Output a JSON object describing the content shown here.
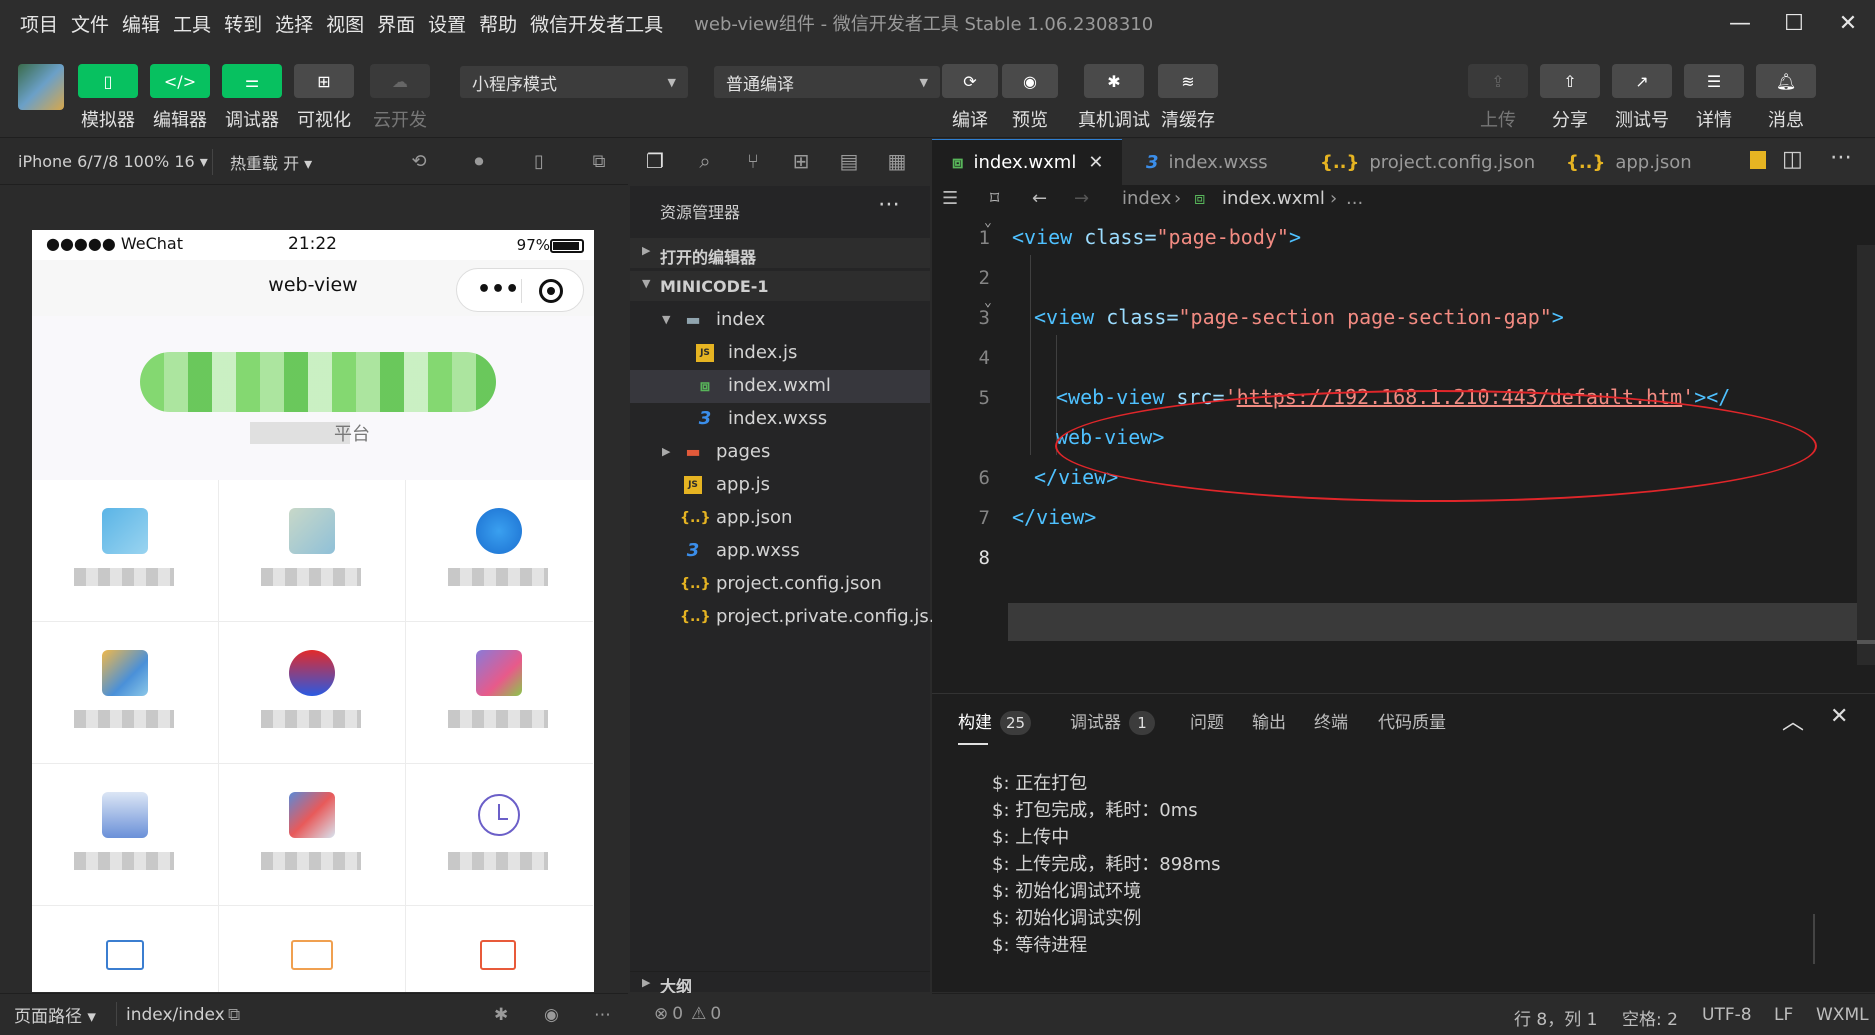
{
  "menu": [
    "项目",
    "文件",
    "编辑",
    "工具",
    "转到",
    "选择",
    "视图",
    "界面",
    "设置",
    "帮助",
    "微信开发者工具"
  ],
  "window_title": "web-view组件 - 微信开发者工具 Stable 1.06.2308310",
  "toolbar": {
    "simulator": "模拟器",
    "editor": "编辑器",
    "debugger": "调试器",
    "visual": "可视化",
    "cloud": "云开发",
    "mode_select": "小程序模式",
    "compile_select": "普通编译",
    "compile": "编译",
    "preview": "预览",
    "remote_debug": "真机调试",
    "clear_cache": "清缓存",
    "upload": "上传",
    "share": "分享",
    "test_id": "测试号",
    "details": "详情",
    "messages": "消息"
  },
  "simulator": {
    "device": "iPhone 6/7/8 100% 16 ▾",
    "hot_reload": "热重载 开 ▾",
    "carrier": "●●●●● WeChat",
    "time": "21:22",
    "battery": "97%",
    "nav_title": "web-view",
    "platform_text": "平台",
    "page_path_label": "页面路径 ▾",
    "page_path": "index/index"
  },
  "explorer": {
    "title": "资源管理器",
    "open_editors": "打开的编辑器",
    "project": "MINICODE-1",
    "files": [
      "index",
      "index.js",
      "index.wxml",
      "index.wxss",
      "pages",
      "app.js",
      "app.json",
      "app.wxss",
      "project.config.json",
      "project.private.config.js..."
    ],
    "outline": "大纲",
    "errors": "0",
    "warnings": "0"
  },
  "tabs": [
    "index.wxml",
    "index.wxss",
    "project.config.json",
    "app.json"
  ],
  "breadcrumb": [
    "index",
    "index.wxml",
    "..."
  ],
  "code": {
    "line_numbers": [
      "1",
      "2",
      "3",
      "4",
      "5",
      "6",
      "7",
      "8"
    ],
    "l1_tag": "<view",
    "l1_attr": " class=",
    "l1_val": "\"page-body\"",
    "l1_end": ">",
    "l3_tag": "<view",
    "l3_attr": " class=",
    "l3_val": "\"page-section page-section-gap\"",
    "l3_end": ">",
    "l5_tag": "<web-view",
    "l5_attr": " src=",
    "l5_q1": "'",
    "l5_url": "https://192.168.1.210:443/default.htm",
    "l5_q2": "'",
    "l5_end": "></",
    "l5b": "web-view>",
    "l6": "</view>",
    "l7": "</view>"
  },
  "panel": {
    "tabs": [
      "构建",
      "调试器",
      "问题",
      "输出",
      "终端",
      "代码质量"
    ],
    "build_count": "25",
    "debugger_count": "1",
    "logs": [
      "$: 正在打包",
      "$: 打包完成，耗时：0ms",
      "$: 上传中",
      "$: 上传完成，耗时：898ms",
      "$: 初始化调试环境",
      "$: 初始化调试实例",
      "$: 等待进程"
    ]
  },
  "status": {
    "position": "行 8，列 1",
    "spaces": "空格: 2",
    "encoding": "UTF-8",
    "eol": "LF",
    "language": "WXML"
  }
}
